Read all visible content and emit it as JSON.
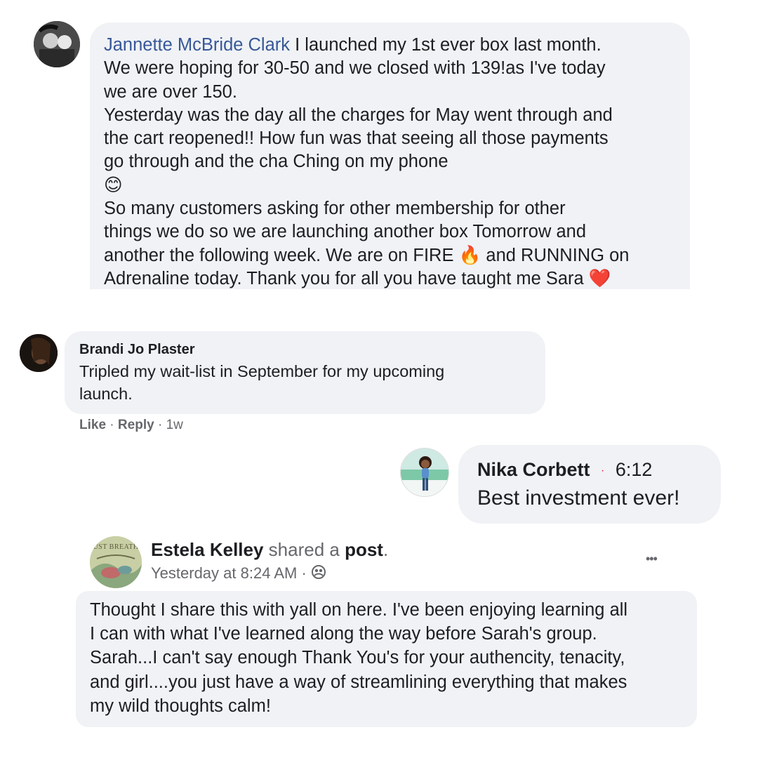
{
  "comment1": {
    "author": "Jannette McBride Clark",
    "line1_rest": " I launched my 1st ever box last month.",
    "line2": "We were hoping for 30-50 and we closed with 139!as I've today",
    "line3": "we are over 150.",
    "line4": "Yesterday was the day all the charges for May went through and",
    "line5": "the cart reopened!! How fun was that seeing all those payments",
    "line6": "go through and the cha Ching on my phone",
    "emoji_smile": "😊",
    "line8": "So many customers asking for other membership for other",
    "line9": "things we do so we are launching another box Tomorrow and",
    "line10_a": "another the following week. We are on FIRE ",
    "emoji_fire": "🔥",
    "line10_b": " and RUNNING on",
    "line11_a": "Adrenaline today. Thank you for all you have taught me Sara ",
    "emoji_heart": "❤️"
  },
  "comment2": {
    "author": "Brandi Jo Plaster",
    "line1": "Tripled my wait-list in September for my upcoming",
    "line2": "launch.",
    "actions": {
      "like": "Like",
      "sep1": " · ",
      "reply": "Reply",
      "sep2": " · ",
      "time": "1w"
    }
  },
  "comment3": {
    "author": "Nika Corbett",
    "dot": "·",
    "time": "6:12",
    "text": "Best investment ever!"
  },
  "post": {
    "author": "Estela Kelley",
    "shared_a": " shared a ",
    "post_word": "post",
    "period": ".",
    "timestamp": "Yesterday at 8:24 AM",
    "sep": " · ",
    "more": "•••",
    "avatar_text": "UST BREATH",
    "line1": "Thought I share this with yall on here. I've been enjoying learning all",
    "line2": "I can with what I've learned along the way before Sarah's group.",
    "line3": "Sarah...I can't say enough Thank You's for your authencity, tenacity,",
    "line4": "and girl....you just have a way of streamlining everything that makes",
    "line5": "my wild thoughts calm!"
  },
  "colors": {
    "bubble": "#f0f2f5",
    "link_blue": "#385898",
    "meta_gray": "#65676b",
    "heart_red": "#e41e3f"
  }
}
